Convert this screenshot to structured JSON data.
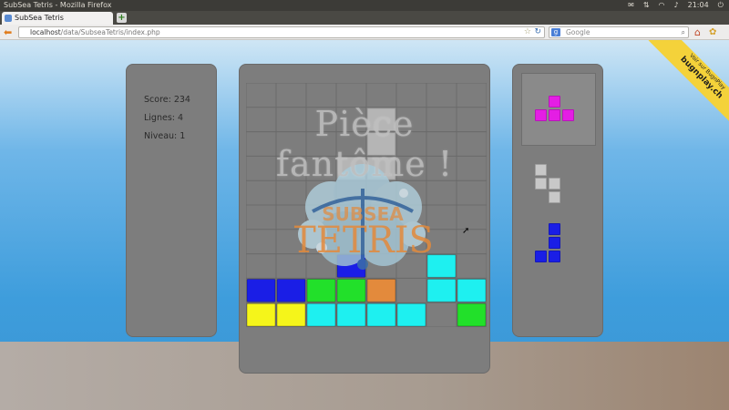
{
  "window": {
    "title": "SubSea Tetris - Mozilla Firefox",
    "clock": "21:04"
  },
  "tab": {
    "title": "SubSea Tetris"
  },
  "address": {
    "host": "localhost",
    "path": "/data/SubseaTetris/index.php"
  },
  "search": {
    "placeholder": "Google",
    "engine_label": "g"
  },
  "stats": {
    "score": "Score: 234",
    "lines": "Lignes: 4",
    "level": "Niveau: 1"
  },
  "overlay": {
    "message": "Pièce fantôme !"
  },
  "logo": {
    "line1": "SUBSEA",
    "line2": "TETRIS"
  },
  "ribbon": {
    "line1": "Voir sur BugnPlay",
    "line2": "bugnplay.ch"
  },
  "colors": {
    "blue": "#1a1ee6",
    "green": "#22e02a",
    "orange": "#e38a3c",
    "cyan": "#1ef0f0",
    "yellow": "#f5f51a",
    "magenta": "#e41ee4",
    "ghost": "#c8c8c8",
    "panel": "#7d7d7d"
  },
  "board": {
    "columns": 8,
    "rows": 10,
    "locked_blocks": [
      {
        "row": 7,
        "col": 3,
        "color": "blue"
      },
      {
        "row": 7,
        "col": 6,
        "color": "cyan"
      },
      {
        "row": 8,
        "col": 0,
        "color": "blue"
      },
      {
        "row": 8,
        "col": 1,
        "color": "blue"
      },
      {
        "row": 8,
        "col": 2,
        "color": "green"
      },
      {
        "row": 8,
        "col": 3,
        "color": "green"
      },
      {
        "row": 8,
        "col": 4,
        "color": "orange"
      },
      {
        "row": 8,
        "col": 6,
        "color": "cyan"
      },
      {
        "row": 8,
        "col": 7,
        "color": "cyan"
      },
      {
        "row": 9,
        "col": 0,
        "color": "yellow"
      },
      {
        "row": 9,
        "col": 1,
        "color": "yellow"
      },
      {
        "row": 9,
        "col": 2,
        "color": "cyan"
      },
      {
        "row": 9,
        "col": 3,
        "color": "cyan"
      },
      {
        "row": 9,
        "col": 4,
        "color": "cyan"
      },
      {
        "row": 9,
        "col": 5,
        "color": "cyan"
      },
      {
        "row": 9,
        "col": 7,
        "color": "green"
      }
    ],
    "ghost_piece": [
      {
        "row": 1,
        "col": 4
      },
      {
        "row": 2,
        "col": 4
      },
      {
        "row": 3,
        "col": 3
      },
      {
        "row": 3,
        "col": 4
      }
    ]
  },
  "queue": [
    {
      "color": "magenta",
      "cells": [
        [
          0,
          1
        ],
        [
          1,
          0
        ],
        [
          1,
          1
        ],
        [
          1,
          2
        ]
      ],
      "in_next_box": true
    },
    {
      "color": "ghost",
      "cells": [
        [
          0,
          0
        ],
        [
          1,
          0
        ],
        [
          1,
          1
        ],
        [
          2,
          1
        ]
      ],
      "in_next_box": false
    },
    {
      "color": "blue",
      "cells": [
        [
          0,
          1
        ],
        [
          1,
          1
        ],
        [
          2,
          0
        ],
        [
          2,
          1
        ]
      ],
      "in_next_box": false
    }
  ]
}
